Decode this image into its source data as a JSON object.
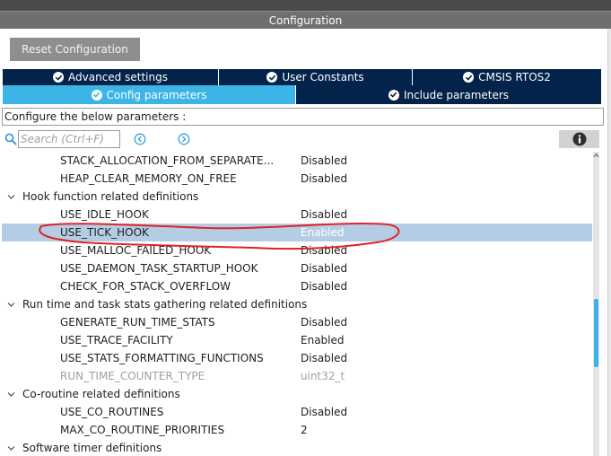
{
  "window": {
    "title": "Configuration"
  },
  "toolbar": {
    "reset_label": "Reset Configuration"
  },
  "tabs_row1": [
    {
      "label": "Advanced settings",
      "icon": "check-circle-icon"
    },
    {
      "label": "User Constants",
      "icon": "check-circle-icon"
    },
    {
      "label": "CMSIS RTOS2",
      "icon": "check-circle-icon"
    }
  ],
  "tabs_row2": [
    {
      "label": "Config parameters",
      "icon": "check-circle-icon",
      "active": true
    },
    {
      "label": "Include parameters",
      "icon": "check-circle-icon",
      "active": false
    }
  ],
  "instruction": "Configure the below parameters :",
  "search": {
    "placeholder": "Search (Ctrl+F)"
  },
  "colors": {
    "navy": "#03234b",
    "accent": "#3cb4e6",
    "selection": "#b5cde4",
    "annotation": "#e0222a"
  },
  "tree": {
    "rows": [
      {
        "type": "param",
        "name": "STACK_ALLOCATION_FROM_SEPARATE...",
        "value": "Disabled"
      },
      {
        "type": "param",
        "name": "HEAP_CLEAR_MEMORY_ON_FREE",
        "value": "Disabled"
      },
      {
        "type": "group",
        "name": "Hook function related definitions"
      },
      {
        "type": "param",
        "name": "USE_IDLE_HOOK",
        "value": "Disabled"
      },
      {
        "type": "param",
        "name": "USE_TICK_HOOK",
        "value": "Enabled",
        "selected": true
      },
      {
        "type": "param",
        "name": "USE_MALLOC_FAILED_HOOK",
        "value": "Disabled"
      },
      {
        "type": "param",
        "name": "USE_DAEMON_TASK_STARTUP_HOOK",
        "value": "Disabled"
      },
      {
        "type": "param",
        "name": "CHECK_FOR_STACK_OVERFLOW",
        "value": "Disabled"
      },
      {
        "type": "group",
        "name": "Run time and task stats gathering related definitions"
      },
      {
        "type": "param",
        "name": "GENERATE_RUN_TIME_STATS",
        "value": "Disabled"
      },
      {
        "type": "param",
        "name": "USE_TRACE_FACILITY",
        "value": "Enabled"
      },
      {
        "type": "param",
        "name": "USE_STATS_FORMATTING_FUNCTIONS",
        "value": "Disabled"
      },
      {
        "type": "param",
        "name": "RUN_TIME_COUNTER_TYPE",
        "value": "uint32_t",
        "disabled": true
      },
      {
        "type": "group",
        "name": "Co-routine related definitions"
      },
      {
        "type": "param",
        "name": "USE_CO_ROUTINES",
        "value": "Disabled"
      },
      {
        "type": "param",
        "name": "MAX_CO_ROUTINE_PRIORITIES",
        "value": "2"
      },
      {
        "type": "group",
        "name": "Software timer definitions"
      }
    ]
  }
}
